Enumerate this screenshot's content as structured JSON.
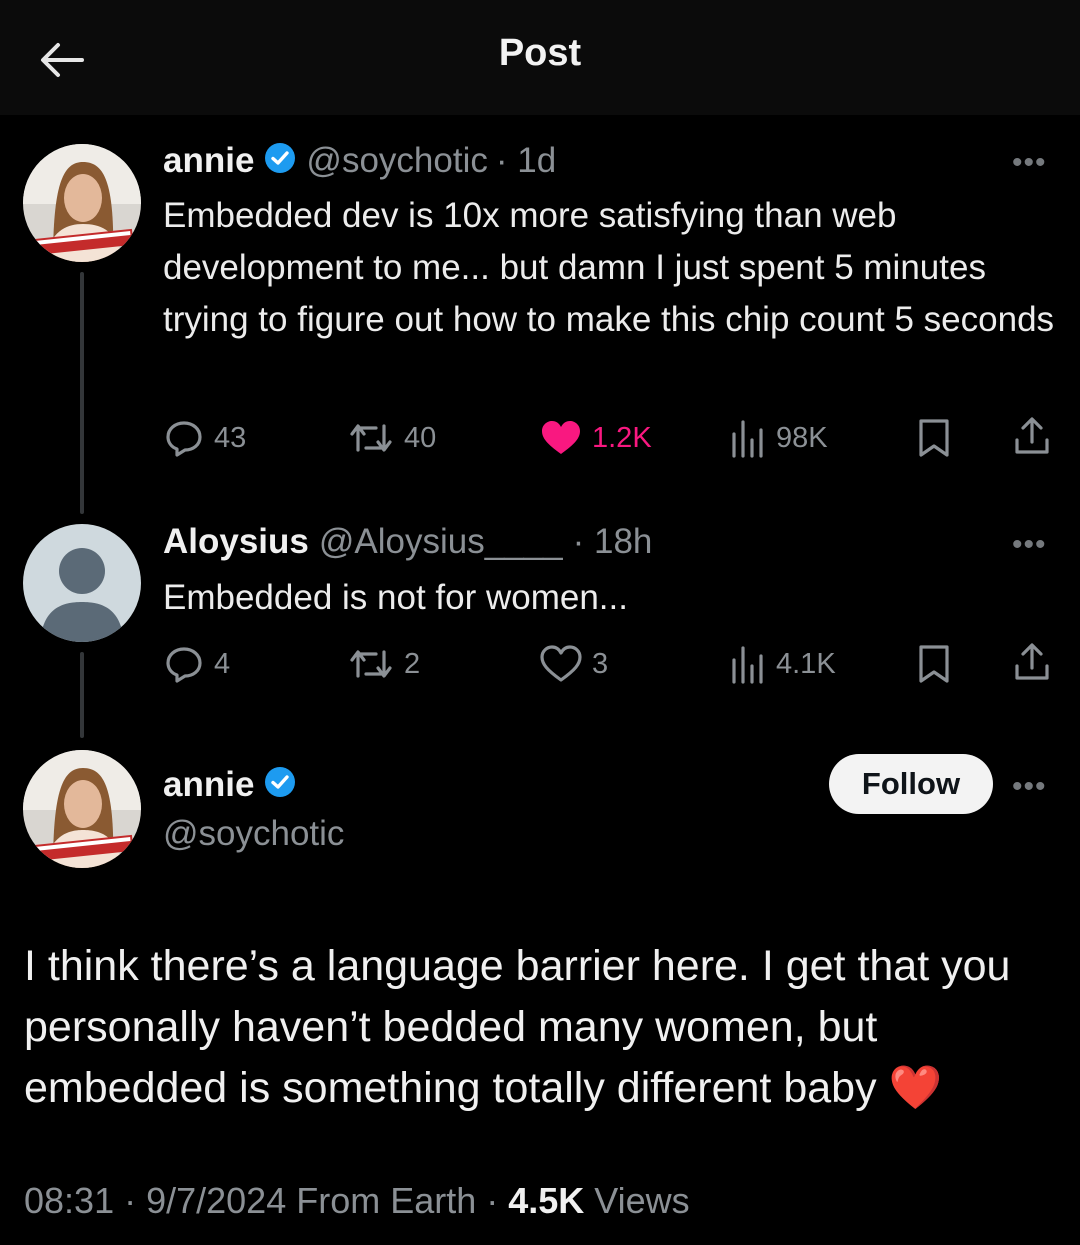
{
  "header": {
    "title": "Post"
  },
  "tweet1": {
    "name": "annie",
    "handle": "@soychotic",
    "time": "· 1d",
    "text": "Embedded dev is 10x more satisfying than web development to me... but damn I just spent 5 minutes trying to figure out how to make this chip count 5 seconds",
    "replies": "43",
    "reposts": "40",
    "likes": "1.2K",
    "views": "98K"
  },
  "tweet2": {
    "name": "Aloysius",
    "handle": "@Aloysius____",
    "time": "· 18h",
    "text": "Embedded is not for women...",
    "replies": "4",
    "reposts": "2",
    "likes": "3",
    "views": "4.1K"
  },
  "main": {
    "name": "annie",
    "handle": "@soychotic",
    "follow_label": "Follow",
    "text": "I think there’s a language barrier here. I get that you personally haven’t bedded many women, but embedded is something totally different baby",
    "emoji": "❤️",
    "footer_time": "08:31 · 9/7/2024 From Earth · ",
    "footer_views": "4.5K",
    "footer_views_label": " Views"
  },
  "colors": {
    "like_active": "#f91880",
    "verified": "#1d9bf0",
    "muted": "#8b9095"
  }
}
